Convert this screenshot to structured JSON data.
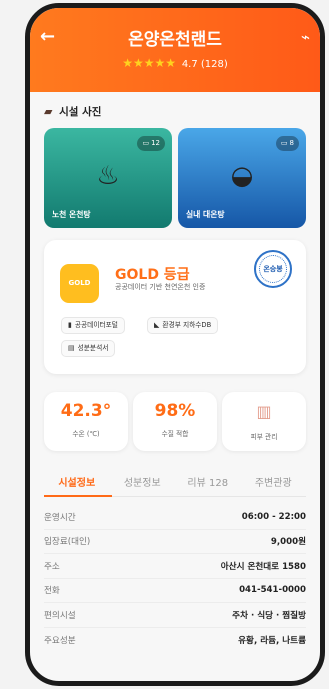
{
  "header": {
    "title": "온양온천랜드",
    "stars": "★★★★★",
    "rating": "4.7 (128)"
  },
  "photos_section": {
    "title": "시설 사진",
    "items": [
      {
        "label": "노천 온천탕",
        "count": "12",
        "icon": "hot-spring-icon"
      },
      {
        "label": "실내 대온탕",
        "count": "8",
        "icon": "bath-icon"
      }
    ]
  },
  "certification": {
    "badge_label": "GOLD",
    "grade": "GOLD 등급",
    "description": "공공데이터 기반 천연온천 인증",
    "seal_text": "온승봉",
    "chips": [
      {
        "label": "공공데이터포털",
        "icon": "chart-icon"
      },
      {
        "label": "환경부 지하수DB",
        "icon": "environment-icon"
      },
      {
        "label": "성분분석서",
        "icon": "document-icon"
      }
    ]
  },
  "stats": {
    "temperature": {
      "value": "42.3°",
      "label": "수온 (℃)"
    },
    "quality": {
      "value": "98%",
      "label": "수질 적합"
    },
    "skin_care": {
      "label": "피부 관리",
      "icon": "lotion-icon"
    }
  },
  "tabs": [
    "시설정보",
    "성분정보",
    "리뷰 128",
    "주변관광"
  ],
  "info_rows": [
    {
      "key": "운영시간",
      "value": "06:00 - 22:00"
    },
    {
      "key": "입장료(대인)",
      "value": "9,000원"
    },
    {
      "key": "주소",
      "value": "아산시 온천대로 1580"
    },
    {
      "key": "전화",
      "value": "041-541-0000"
    },
    {
      "key": "편의시설",
      "value": "주차 · 식당 · 찜질방"
    },
    {
      "key": "주요성분",
      "value": "유황, 라듐, 나트륨"
    }
  ],
  "colors": {
    "accent": "#ff6a18",
    "header_gradient": "#ff7a1e",
    "gold": "#ffbe1f"
  }
}
